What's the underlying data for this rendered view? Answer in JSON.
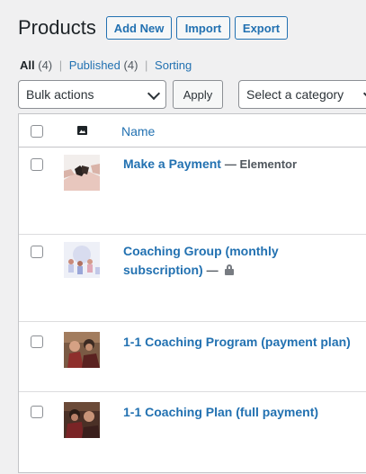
{
  "header": {
    "title": "Products",
    "buttons": {
      "add_new": "Add New",
      "import": "Import",
      "export": "Export"
    }
  },
  "views": {
    "all": {
      "label": "All",
      "count": "(4)"
    },
    "published": {
      "label": "Published",
      "count": "(4)"
    },
    "separator": "|",
    "sorting": {
      "label": "Sorting"
    }
  },
  "tablenav": {
    "bulk_actions": "Bulk actions",
    "apply": "Apply",
    "category": "Select a category"
  },
  "table": {
    "columns": {
      "image_icon": "image-icon",
      "name": "Name"
    },
    "rows": [
      {
        "name": "Make a Payment",
        "state": "— Elementor",
        "locked": false,
        "thumb": "handshake-photo"
      },
      {
        "name": "Coaching Group (monthly subscription)",
        "state": "—",
        "locked": true,
        "thumb": "group-photo"
      },
      {
        "name": "1-1 Coaching Program (payment plan)",
        "state": "",
        "locked": false,
        "thumb": "coaching-photo"
      },
      {
        "name": "1-1 Coaching Plan (full payment)",
        "state": "",
        "locked": false,
        "thumb": "coaching-photo-2"
      }
    ]
  },
  "colors": {
    "link": "#2271b1",
    "text": "#1d2327",
    "background": "#f0f0f1"
  }
}
